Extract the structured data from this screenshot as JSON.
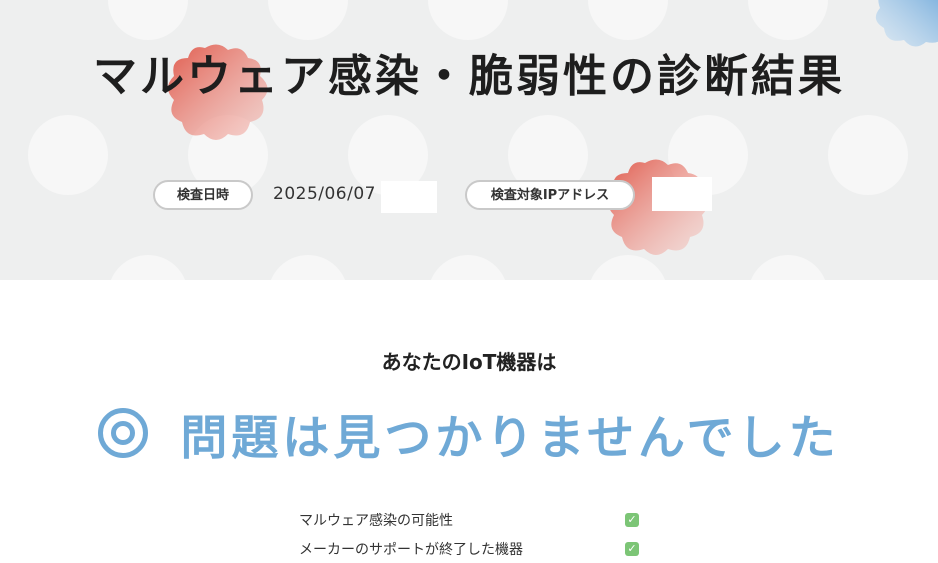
{
  "hero": {
    "title": "マルウェア感染・脆弱性の診断結果",
    "date_label": "検査日時",
    "date_value": "2025/06/07",
    "ip_label": "検査対象IPアドレス",
    "ip_value": ""
  },
  "result": {
    "subtitle": "あなたのIoT機器は",
    "icon": "double-circle-icon",
    "message": "問題は見つかりませんでした"
  },
  "checks": [
    {
      "label": "マルウェア感染の可能性",
      "icon": "checkmark-icon",
      "status": "ok"
    },
    {
      "label": "メーカーのサポートが終了した機器",
      "icon": "checkmark-icon",
      "status": "ok"
    }
  ],
  "colors": {
    "hero_background": "#eeefef",
    "accent_blue": "#6fa9d6",
    "blob_red": "#e05a4c",
    "check_green": "#7cc576"
  }
}
